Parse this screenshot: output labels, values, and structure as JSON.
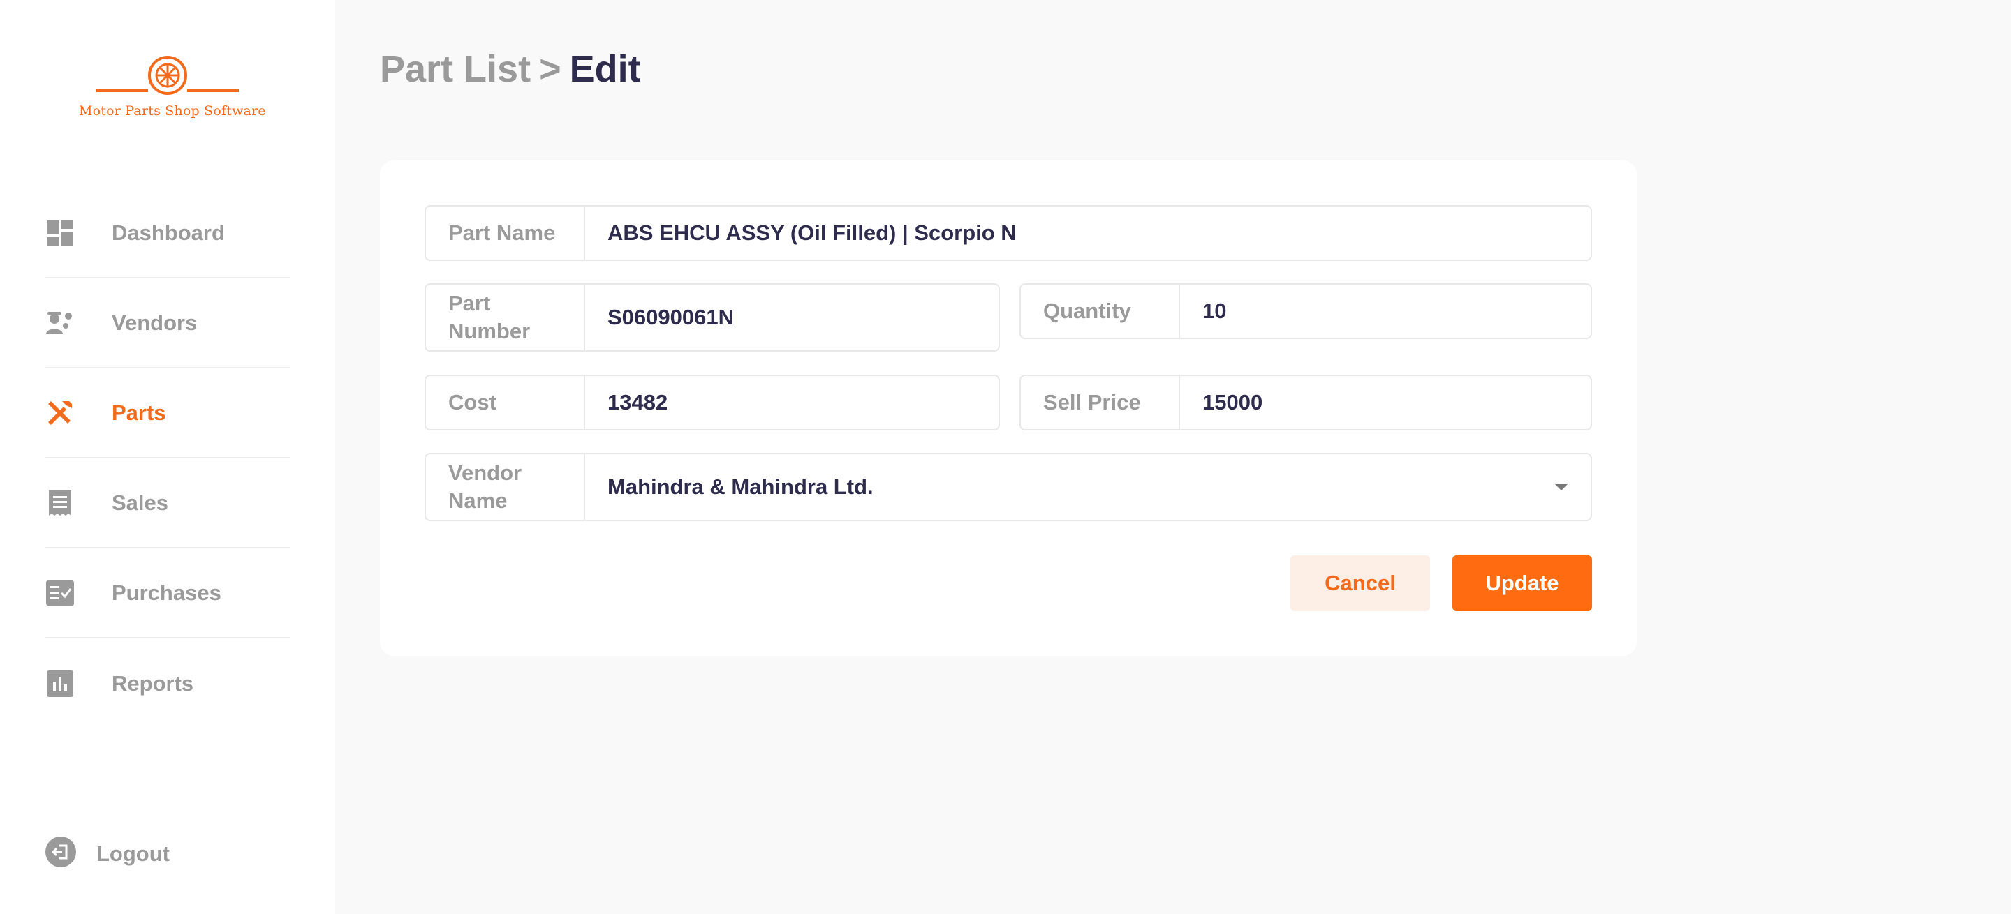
{
  "app": {
    "logo_text": "Motor Parts Shop Software"
  },
  "sidebar": {
    "items": [
      {
        "label": "Dashboard",
        "icon": "dashboard-icon"
      },
      {
        "label": "Vendors",
        "icon": "vendors-icon"
      },
      {
        "label": "Parts",
        "icon": "tools-icon",
        "active": true
      },
      {
        "label": "Sales",
        "icon": "receipt-icon"
      },
      {
        "label": "Purchases",
        "icon": "purchases-icon"
      },
      {
        "label": "Reports",
        "icon": "reports-icon"
      }
    ],
    "logout_label": "Logout"
  },
  "breadcrumb": {
    "parent": "Part List",
    "separator": ">",
    "current": "Edit"
  },
  "form": {
    "part_name": {
      "label": "Part Name",
      "value": "ABS EHCU ASSY (Oil Filled) | Scorpio N"
    },
    "part_number": {
      "label": "Part Number",
      "value": "S06090061N"
    },
    "quantity": {
      "label": "Quantity",
      "value": "10"
    },
    "cost": {
      "label": "Cost",
      "value": "13482"
    },
    "sell_price": {
      "label": "Sell Price",
      "value": "15000"
    },
    "vendor_name": {
      "label": "Vendor Name",
      "value": "Mahindra & Mahindra Ltd."
    }
  },
  "actions": {
    "cancel_label": "Cancel",
    "update_label": "Update"
  },
  "colors": {
    "accent": "#f26b1d",
    "text_dark": "#2e2b4d",
    "text_muted": "#9a9a9a"
  }
}
